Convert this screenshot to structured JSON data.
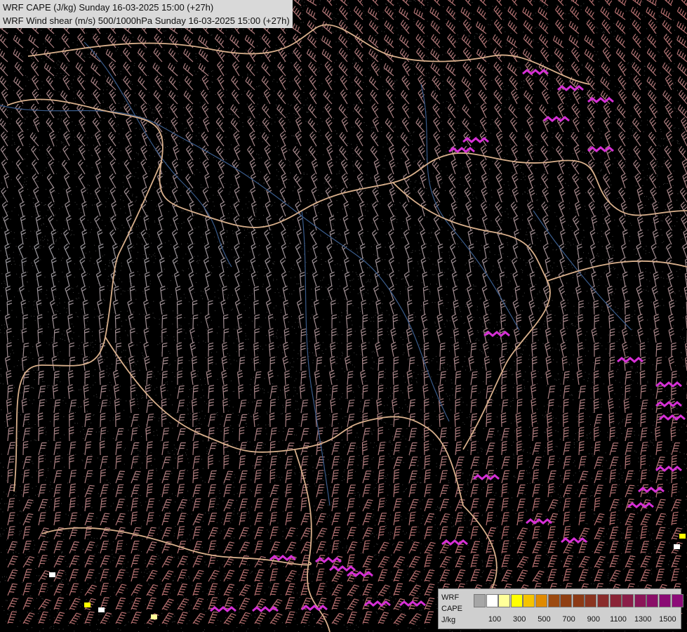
{
  "title": {
    "line1": "WRF CAPE (J/kg) Sunday 16-03-2025 15:00 (+27h)",
    "line2": "WRF Wind shear (m/s) 500/1000hPa Sunday 16-03-2025 15:00 (+27h)"
  },
  "legend": {
    "label_model": "WRF",
    "label_var": "CAPE",
    "label_unit": "J/kg",
    "colors": [
      "#a6a6a6",
      "#ffffff",
      "#ffff99",
      "#ffff00",
      "#f5c400",
      "#e08a00",
      "#9c4a10",
      "#8f3e12",
      "#8c3a16",
      "#8a3420",
      "#8a2c2c",
      "#8a2436",
      "#8a1e48",
      "#8a1658",
      "#8a0e68",
      "#8a0a74",
      "#8c0c78"
    ],
    "ticks": [
      "100",
      "300",
      "500",
      "700",
      "900",
      "1100",
      "1300",
      "1500"
    ]
  },
  "colors": {
    "background": "#000000",
    "border_line": "#d9b08c",
    "river": "#3a5c8c",
    "barb_strong": "#b87070",
    "barb_weak": "#9a9aa0",
    "cape_high": "#d630d6"
  }
}
